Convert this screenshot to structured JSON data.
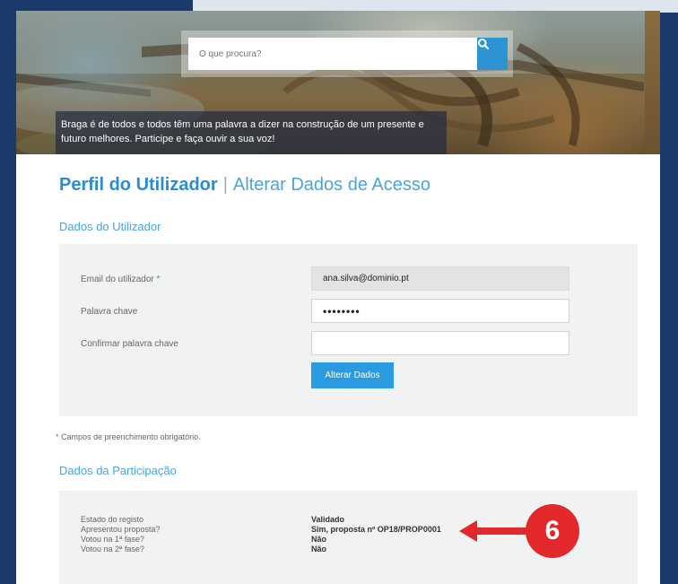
{
  "search": {
    "placeholder": "O que procura?"
  },
  "hero": {
    "tagline": "Braga é de todos e todos têm uma palavra a dizer na construção de um presente e futuro melhores. Participe e faça ouvir a sua voz!"
  },
  "header": {
    "title": "Perfil do Utilizador",
    "separator": "|",
    "link": "Alterar Dados de Acesso"
  },
  "user_section": {
    "title": "Dados do Utilizador",
    "email_label": "Email do utilizador",
    "required_mark": "*",
    "email_value": "ana.silva@dominio.pt",
    "password_label": "Palavra chave",
    "password_value": "••••••••",
    "confirm_label": "Confirmar palavra chave",
    "confirm_value": "",
    "submit_label": "Alterar Dados"
  },
  "required_note": {
    "star": "*",
    "text": " Campos de preenchimento obrigatório."
  },
  "participation_section": {
    "title": "Dados da Participação",
    "rows": [
      {
        "label": "Estado do registo",
        "value": "Validado"
      },
      {
        "label": "Apresentou proposta?",
        "value": "Sim, proposta nº OP18/PROP0001"
      },
      {
        "label": "Votou na 1ª fase?",
        "value": "Não"
      },
      {
        "label": "Votou na 2ª fase?",
        "value": "Não"
      }
    ]
  },
  "callout": {
    "number": "6"
  },
  "colors": {
    "accent": "#2a8dd1",
    "button": "#2a9be0",
    "callout": "#e3282c",
    "frame": "#1b3a6b"
  },
  "icons": {
    "search": "search-icon",
    "callout_arrow": "arrow-left-icon"
  }
}
